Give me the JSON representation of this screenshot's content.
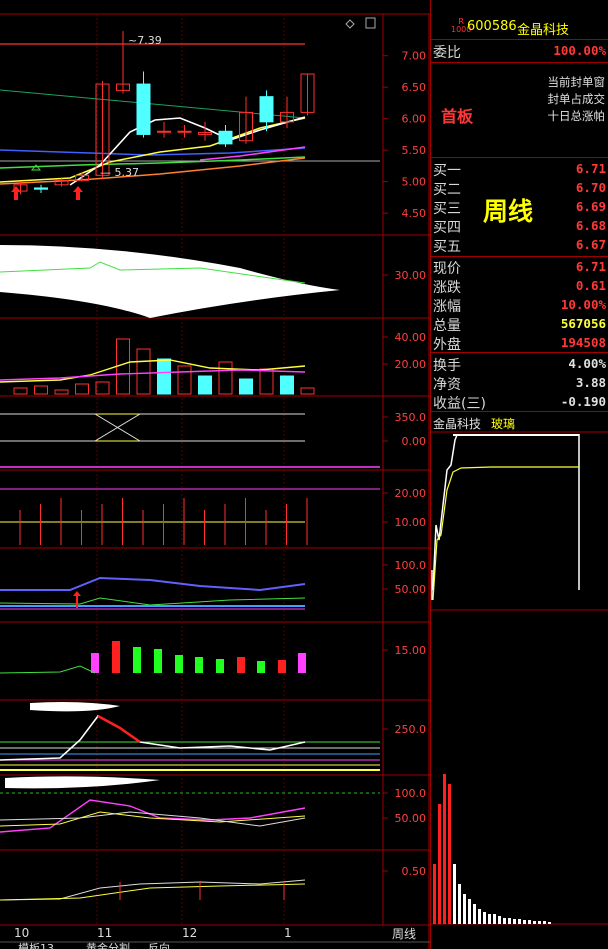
{
  "stock": {
    "badge_top": "R",
    "badge_bottom": "1000",
    "code": "600586",
    "name": "金晶科技"
  },
  "commission": {
    "label": "委比",
    "value": "100.00%"
  },
  "limit_tag": "首板",
  "notes": [
    "当前封单窗",
    "封单占成交",
    "十日总涨帕"
  ],
  "period_label": "周线",
  "bids": [
    {
      "label": "买一",
      "value": "6.71"
    },
    {
      "label": "买二",
      "value": "6.70"
    },
    {
      "label": "买三",
      "value": "6.69"
    },
    {
      "label": "买四",
      "value": "6.68"
    },
    {
      "label": "买五",
      "value": "6.67"
    }
  ],
  "quote": [
    {
      "label": "现价",
      "value": "6.71",
      "color": "red"
    },
    {
      "label": "涨跌",
      "value": "0.61",
      "color": "red"
    },
    {
      "label": "涨幅",
      "value": "10.00%",
      "color": "red"
    },
    {
      "label": "总量",
      "value": "567056",
      "color": "yel"
    },
    {
      "label": "外盘",
      "value": "194508",
      "color": "red"
    }
  ],
  "fund": [
    {
      "label": "换手",
      "value": "4.00%",
      "color": "wht"
    },
    {
      "label": "净资",
      "value": "3.88",
      "color": "wht"
    },
    {
      "label": "收益(三)",
      "value": "-0.190",
      "color": "wht"
    }
  ],
  "mini_chart": {
    "title": "金晶科技",
    "tag": "玻璃"
  },
  "bottom_tab": "周线",
  "price_axis": [
    "7.00",
    "6.50",
    "6.00",
    "5.50",
    "5.00",
    "4.50"
  ],
  "annotations": {
    "high": "7.39",
    "low": "5.37"
  },
  "pane_ticks": [
    [
      "30.00"
    ],
    [
      "40.00",
      "20.00"
    ],
    [
      "350.0",
      "0.00"
    ],
    [
      "20.00",
      "10.00"
    ],
    [
      "100.0",
      "50.00"
    ],
    [
      "15.00"
    ],
    [
      "250.0"
    ],
    [
      "100.0",
      "50.00"
    ],
    [
      "0.50"
    ]
  ],
  "x_months": [
    "10",
    "11",
    "12",
    "1"
  ],
  "bottom_bar_items": [
    "模板13",
    "黄金分割",
    "反向"
  ],
  "chart_data": {
    "type": "candlestick",
    "candles": [
      {
        "o": 4.85,
        "c": 4.95,
        "h": 5.0,
        "l": 4.8
      },
      {
        "o": 4.9,
        "c": 4.88,
        "h": 4.95,
        "l": 4.82
      },
      {
        "o": 4.95,
        "c": 5.02,
        "h": 5.05,
        "l": 4.92
      },
      {
        "o": 5.02,
        "c": 5.1,
        "h": 5.15,
        "l": 5.0
      },
      {
        "o": 5.1,
        "c": 6.55,
        "h": 6.6,
        "l": 5.05
      },
      {
        "o": 6.45,
        "c": 6.55,
        "h": 7.39,
        "l": 6.4
      },
      {
        "o": 6.55,
        "c": 5.75,
        "h": 6.75,
        "l": 5.7
      },
      {
        "o": 5.8,
        "c": 5.8,
        "h": 5.95,
        "l": 5.7
      },
      {
        "o": 5.8,
        "c": 5.8,
        "h": 5.9,
        "l": 5.7
      },
      {
        "o": 5.75,
        "c": 5.78,
        "h": 5.95,
        "l": 5.65
      },
      {
        "o": 5.8,
        "c": 5.6,
        "h": 5.9,
        "l": 5.55
      },
      {
        "o": 5.65,
        "c": 6.1,
        "h": 6.35,
        "l": 5.6
      },
      {
        "o": 6.35,
        "c": 5.95,
        "h": 6.45,
        "l": 5.8
      },
      {
        "o": 5.95,
        "c": 6.1,
        "h": 6.35,
        "l": 5.85
      },
      {
        "o": 6.1,
        "c": 6.71,
        "h": 6.71,
        "l": 6.05
      }
    ]
  }
}
